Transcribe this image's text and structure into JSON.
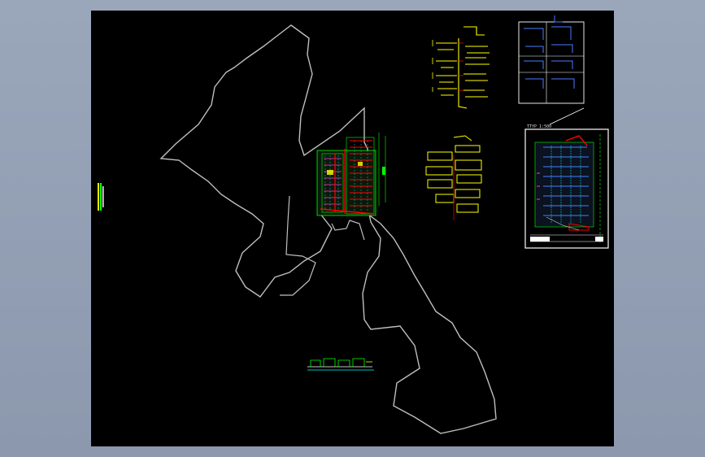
{
  "colors": {
    "outline": "#bfbfbf",
    "yellow": "#ffff00",
    "green": "#00ff00",
    "red": "#ff0000",
    "blue": "#4a7dff",
    "white": "#ffffff",
    "cyan": "#00ffff",
    "magenta": "#ff33cc"
  },
  "labels": {
    "plan_title": "TTYP 1:500",
    "yellow_pipe_caption": "",
    "blue_pipe_caption": "",
    "small_yellow_caption": ""
  }
}
